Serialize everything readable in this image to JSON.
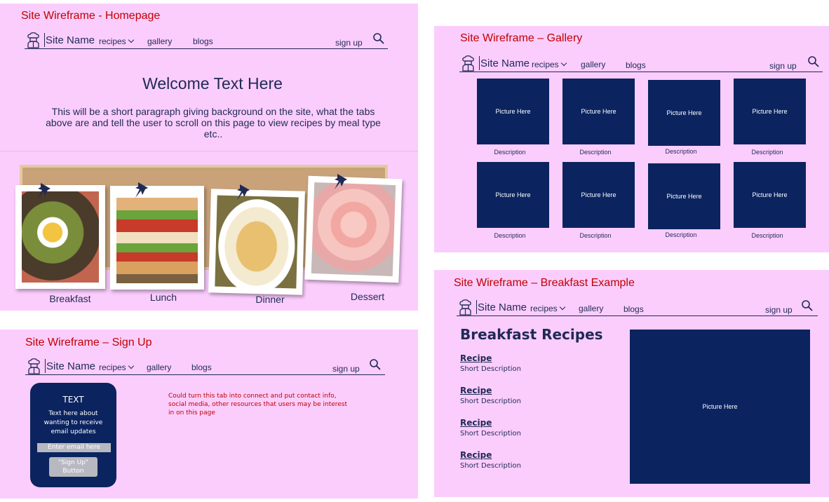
{
  "nav": {
    "site_name": "Site Name",
    "recipes": "recipes",
    "gallery": "gallery",
    "blogs": "blogs",
    "signup": "sign up"
  },
  "homepage": {
    "title": "Site Wireframe - Homepage",
    "welcome": "Welcome Text Here",
    "paragraph": "This will be a short paragraph giving background on the site, what the tabs above are and tell the user to scroll on this page to view recipes by meal type etc..",
    "meals": [
      "Breakfast",
      "Lunch",
      "Dinner",
      "Dessert"
    ]
  },
  "gallery": {
    "title": "Site Wireframe – Gallery",
    "picture_label": "Picture Here",
    "description_label": "Description"
  },
  "signup": {
    "title": "Site Wireframe – Sign Up",
    "card_heading": "TEXT",
    "card_body": "Text here about wanting to receive email updates",
    "email_placeholder": "Enter email here",
    "button_label": "\"Sign Up\" Button",
    "note": "Could turn this tab into connect and put contact info, social media, other resources that users may be interest in on this page"
  },
  "breakfast": {
    "title": "Site Wireframe – Breakfast Example",
    "heading": "Breakfast Recipes",
    "recipes": [
      {
        "name": "Recipe",
        "desc": "Short Description"
      },
      {
        "name": "Recipe",
        "desc": "Short Description"
      },
      {
        "name": "Recipe",
        "desc": "Short Description"
      },
      {
        "name": "Recipe",
        "desc": "Short Description"
      }
    ],
    "picture_label": "Picture Here"
  },
  "colors": {
    "panel_bg": "#fbcdfd",
    "navy": "#0b2460",
    "title_red": "#c00000"
  }
}
